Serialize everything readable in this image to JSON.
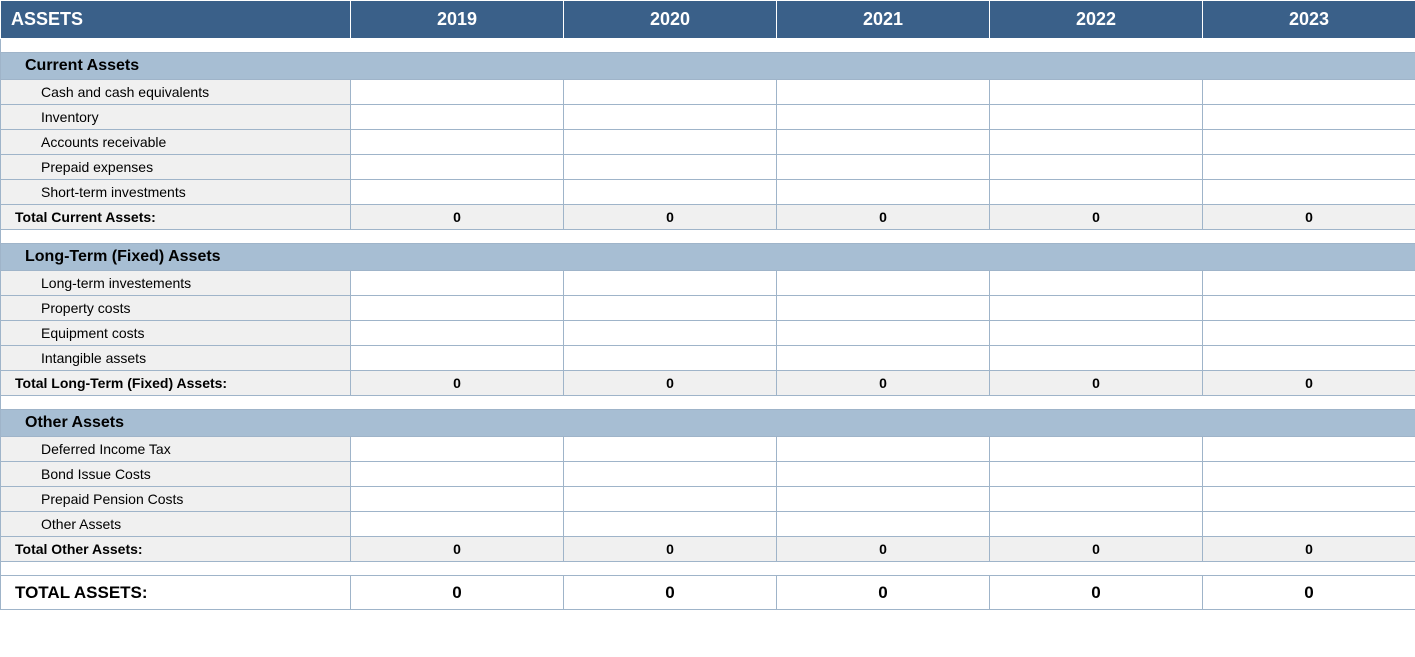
{
  "header": {
    "title": "ASSETS",
    "years": [
      "2019",
      "2020",
      "2021",
      "2022",
      "2023"
    ]
  },
  "sections": [
    {
      "name": "Current Assets",
      "items": [
        {
          "label": "Cash and cash equivalents",
          "values": [
            "",
            "",
            "",
            "",
            ""
          ]
        },
        {
          "label": "Inventory",
          "values": [
            "",
            "",
            "",
            "",
            ""
          ]
        },
        {
          "label": "Accounts receivable",
          "values": [
            "",
            "",
            "",
            "",
            ""
          ]
        },
        {
          "label": "Prepaid expenses",
          "values": [
            "",
            "",
            "",
            "",
            ""
          ]
        },
        {
          "label": "Short-term investments",
          "values": [
            "",
            "",
            "",
            "",
            ""
          ]
        }
      ],
      "subtotal": {
        "label": "Total Current Assets:",
        "values": [
          "0",
          "0",
          "0",
          "0",
          "0"
        ]
      }
    },
    {
      "name": "Long-Term (Fixed) Assets",
      "items": [
        {
          "label": "Long-term investements",
          "values": [
            "",
            "",
            "",
            "",
            ""
          ]
        },
        {
          "label": "Property costs",
          "values": [
            "",
            "",
            "",
            "",
            ""
          ]
        },
        {
          "label": "Equipment costs",
          "values": [
            "",
            "",
            "",
            "",
            ""
          ]
        },
        {
          "label": "Intangible assets",
          "values": [
            "",
            "",
            "",
            "",
            ""
          ]
        }
      ],
      "subtotal": {
        "label": "Total Long-Term (Fixed) Assets:",
        "values": [
          "0",
          "0",
          "0",
          "0",
          "0"
        ]
      }
    },
    {
      "name": "Other Assets",
      "items": [
        {
          "label": "Deferred Income Tax",
          "values": [
            "",
            "",
            "",
            "",
            ""
          ]
        },
        {
          "label": "Bond Issue Costs",
          "values": [
            "",
            "",
            "",
            "",
            ""
          ]
        },
        {
          "label": "Prepaid Pension Costs",
          "values": [
            "",
            "",
            "",
            "",
            ""
          ]
        },
        {
          "label": "Other Assets",
          "values": [
            "",
            "",
            "",
            "",
            ""
          ]
        }
      ],
      "subtotal": {
        "label": "Total Other Assets:",
        "values": [
          "0",
          "0",
          "0",
          "0",
          "0"
        ]
      }
    }
  ],
  "grand_total": {
    "label": "TOTAL ASSETS:",
    "values": [
      "0",
      "0",
      "0",
      "0",
      "0"
    ]
  }
}
